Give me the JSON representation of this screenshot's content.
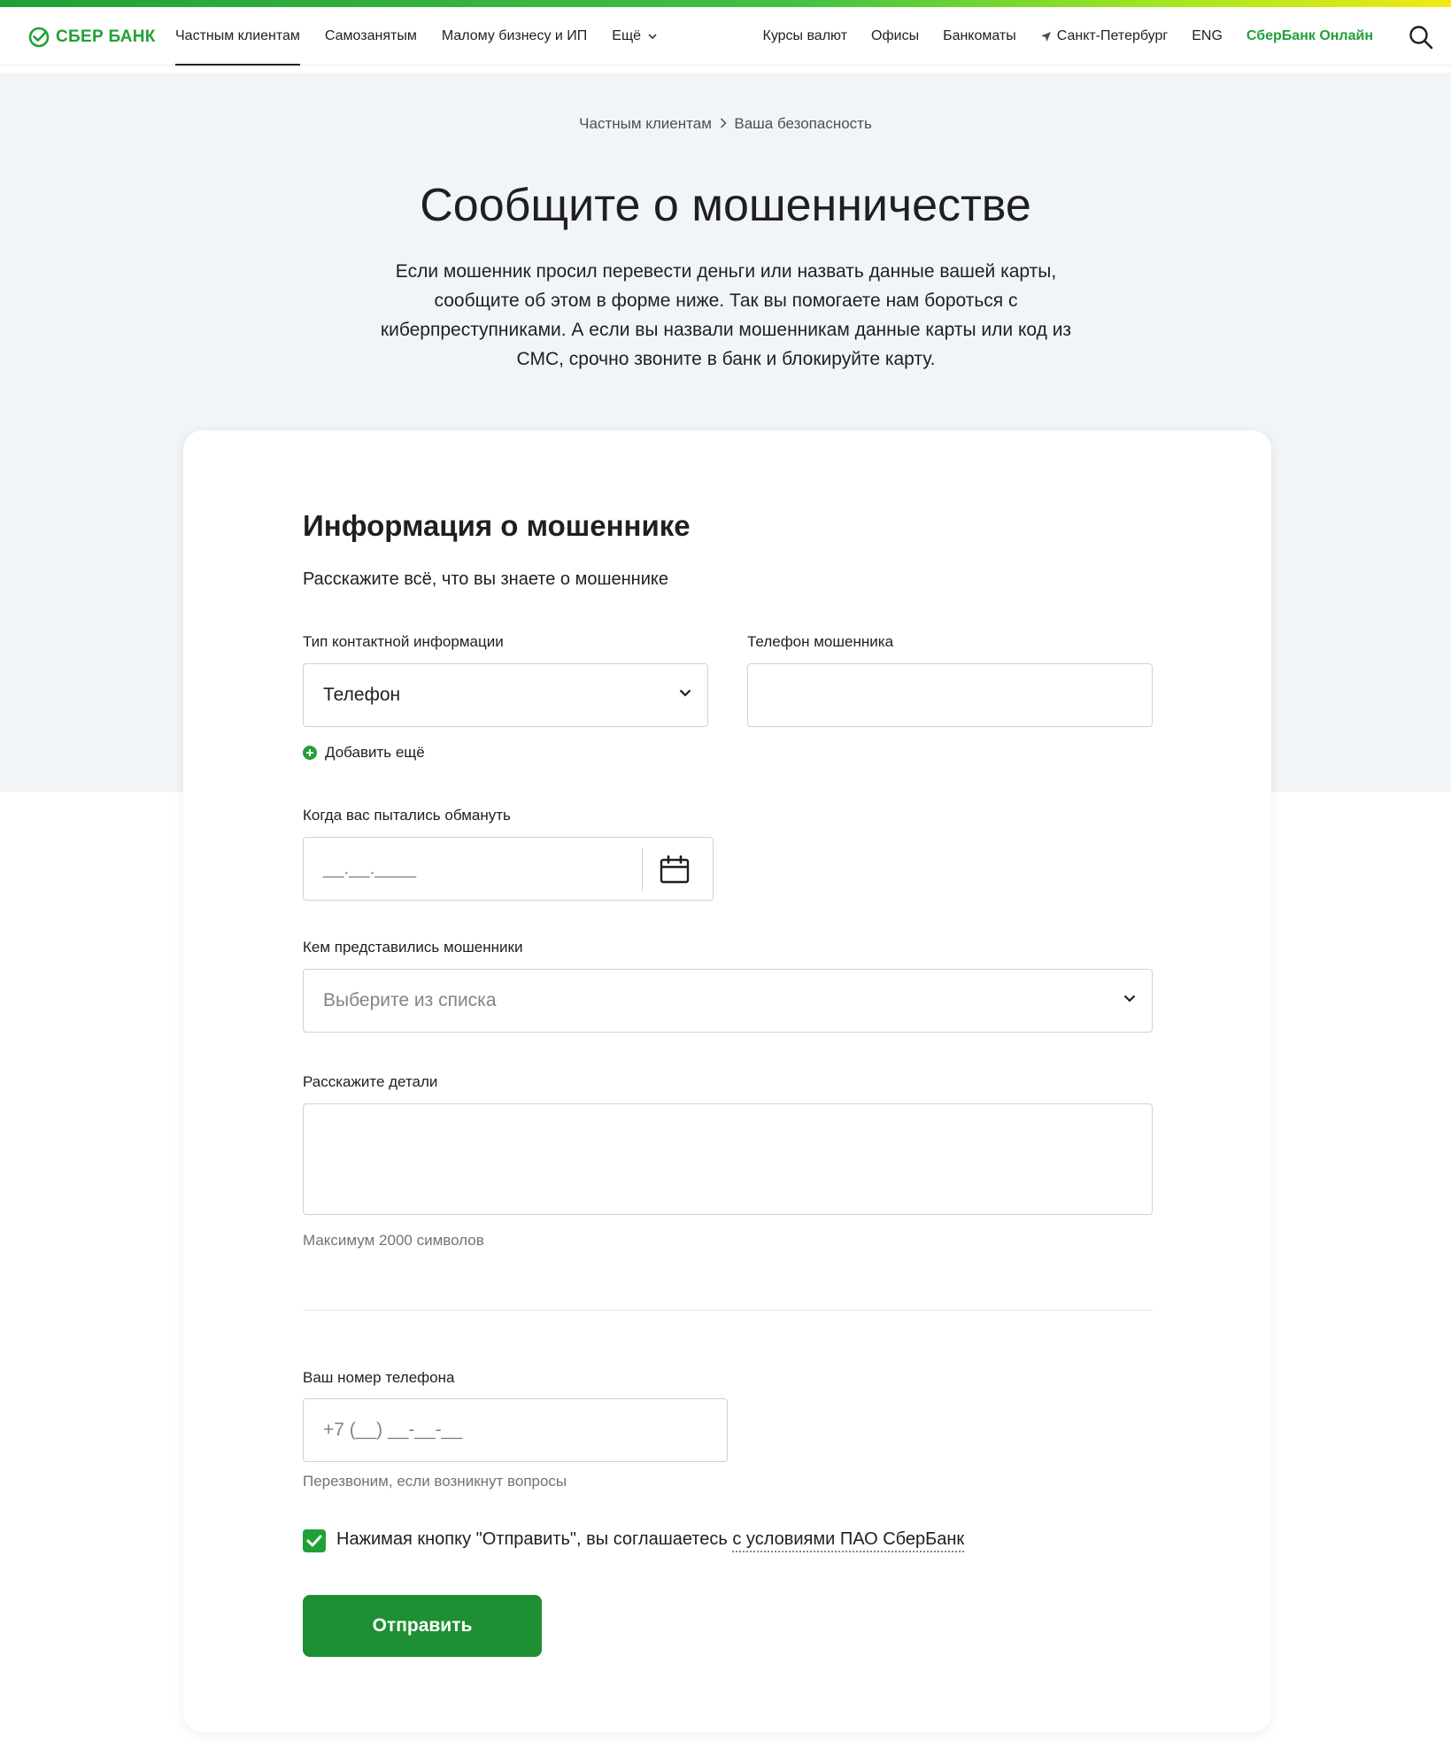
{
  "header": {
    "logo_text": "СБЕР БАНК",
    "nav_left": [
      "Частным клиентам",
      "Самозанятым",
      "Малому бизнесу и ИП",
      "Ещё"
    ],
    "nav_right": {
      "rates": "Курсы валют",
      "offices": "Офисы",
      "atms": "Банкоматы",
      "city": "Санкт-Петербург",
      "lang": "ENG",
      "online": "СберБанк Онлайн"
    }
  },
  "breadcrumb": {
    "parent": "Частным клиентам",
    "current": "Ваша безопасность"
  },
  "page": {
    "title": "Сообщите о мошенничестве",
    "lead": "Если мошенник просил перевести деньги или назвать данные вашей карты, сообщите об этом в форме ниже. Так вы помогаете нам бороться с киберпреступниками. А если вы назвали мошенникам данные карты или код из СМС, срочно звоните в банк и блокируйте карту."
  },
  "form": {
    "section_title": "Информация о мошеннике",
    "section_subtitle": "Расскажите всё, что вы знаете о мошеннике",
    "contact_type": {
      "label": "Тип контактной информации",
      "value": "Телефон"
    },
    "fraud_phone": {
      "label": "Телефон мошенника",
      "value": ""
    },
    "add_more": "Добавить ещё",
    "date": {
      "label": "Когда вас пытались обмануть",
      "placeholder": "__.__.____"
    },
    "impersonated": {
      "label": "Кем представились мошенники",
      "placeholder": "Выберите из списка"
    },
    "details": {
      "label": "Расскажите детали",
      "hint": "Максимум 2000 символов"
    },
    "your_phone": {
      "label": "Ваш номер телефона",
      "placeholder": "+7 (__) __-__-__",
      "hint": "Перезвоним, если возникнут вопросы"
    },
    "consent": {
      "text": "Нажимая кнопку \"Отправить\", вы соглашаетесь ",
      "link": "с условиями ПАО СберБанк",
      "checked": true
    },
    "submit_label": "Отправить"
  },
  "colors": {
    "brand": "#21a038",
    "button": "#1e8f32",
    "hero_bg": "#f2f5f7"
  },
  "icons": [
    "sber-logo-icon",
    "chevron-down-icon",
    "location-arrow-icon",
    "search-icon",
    "plus-circle-icon",
    "calendar-icon",
    "checkmark-icon"
  ]
}
